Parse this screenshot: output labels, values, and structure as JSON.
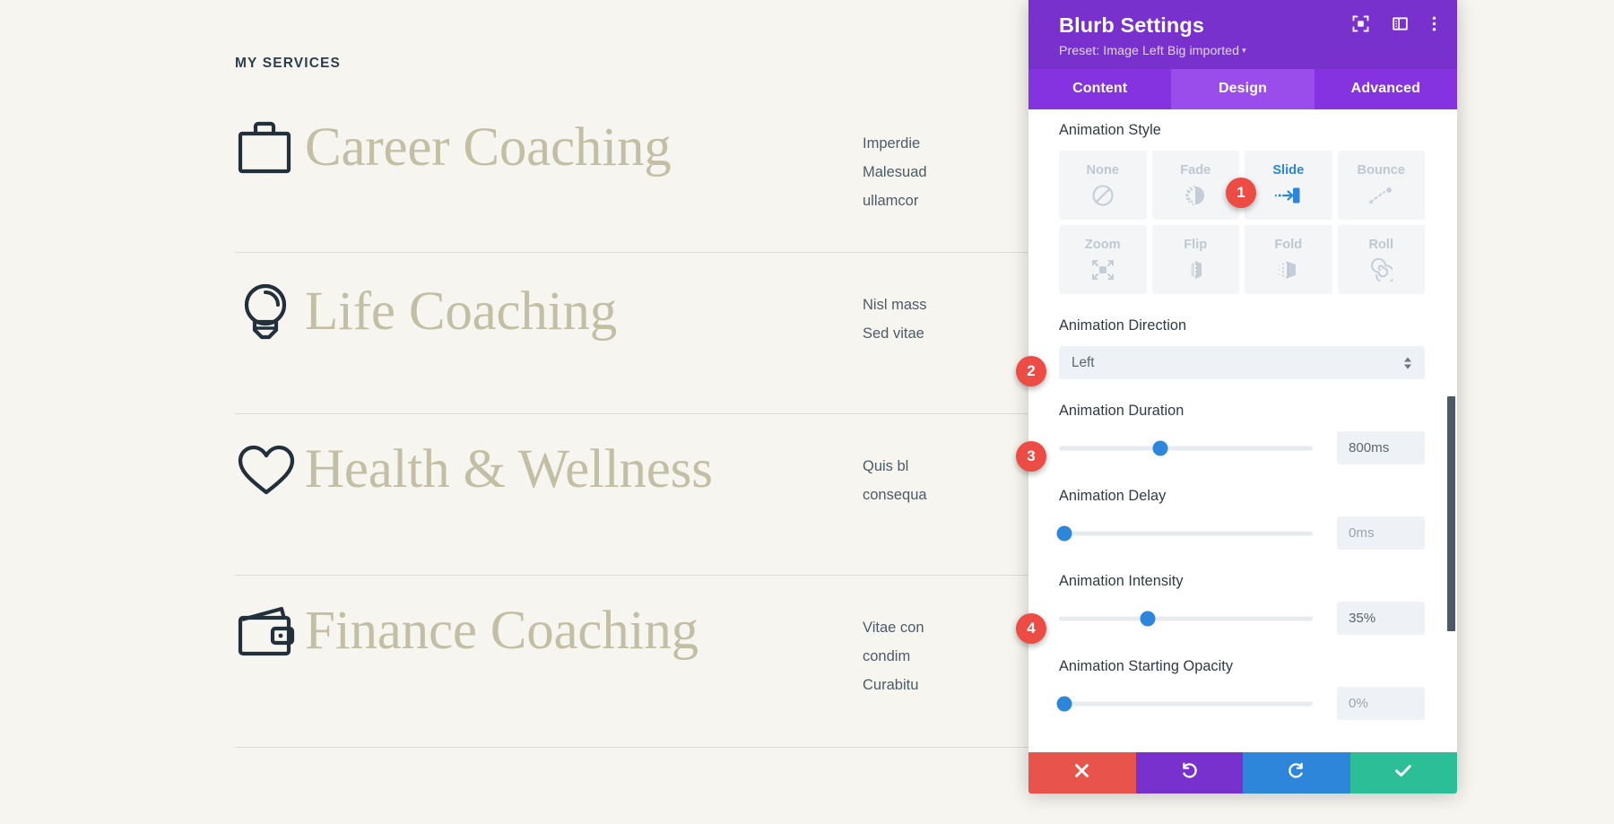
{
  "page": {
    "eyebrow": "MY SERVICES",
    "services": [
      {
        "icon": "briefcase-icon",
        "title": "Career Coaching",
        "body_lines": [
          "Imperdie",
          "Malesuad",
          "ullamcor"
        ]
      },
      {
        "icon": "lightbulb-icon",
        "title": "Life Coaching",
        "body_lines": [
          "Nisl mass",
          "Sed vitae"
        ]
      },
      {
        "icon": "heart-icon",
        "title": "Health & Wellness",
        "body_lines": [
          "Quis bl",
          "consequa"
        ]
      },
      {
        "icon": "wallet-icon",
        "title": "Finance Coaching",
        "body_lines": [
          "Vitae con",
          "condim",
          "Curabitu"
        ]
      }
    ]
  },
  "modal": {
    "title": "Blurb Settings",
    "preset_label": "Preset: Image Left Big imported",
    "preset_caret": "▾",
    "header_icons": [
      {
        "name": "focus-target-icon"
      },
      {
        "name": "layout-columns-icon"
      },
      {
        "name": "more-vertical-icon"
      }
    ],
    "tabs": [
      {
        "label": "Content",
        "active": false
      },
      {
        "label": "Design",
        "active": true
      },
      {
        "label": "Advanced",
        "active": false
      }
    ],
    "animation_style": {
      "label": "Animation Style",
      "options": [
        {
          "label": "None",
          "icon": "no-entry-icon",
          "selected": false
        },
        {
          "label": "Fade",
          "icon": "fade-icon",
          "selected": false
        },
        {
          "label": "Slide",
          "icon": "slide-icon",
          "selected": true
        },
        {
          "label": "Bounce",
          "icon": "bounce-icon",
          "selected": false
        },
        {
          "label": "Zoom",
          "icon": "zoom-arrows-icon",
          "selected": false
        },
        {
          "label": "Flip",
          "icon": "flip-icon",
          "selected": false
        },
        {
          "label": "Fold",
          "icon": "fold-icon",
          "selected": false
        },
        {
          "label": "Roll",
          "icon": "roll-spiral-icon",
          "selected": false
        }
      ]
    },
    "animation_direction": {
      "label": "Animation Direction",
      "value": "Left"
    },
    "animation_duration": {
      "label": "Animation Duration",
      "value": "800ms",
      "knob_percent": 40
    },
    "animation_delay": {
      "label": "Animation Delay",
      "value": "0ms",
      "knob_percent": 2
    },
    "animation_intensity": {
      "label": "Animation Intensity",
      "value": "35%",
      "knob_percent": 35
    },
    "animation_starting_opacity": {
      "label": "Animation Starting Opacity",
      "value": "0%",
      "knob_percent": 2
    },
    "footer": [
      {
        "name": "cancel-button",
        "icon": "x-icon",
        "color": "#e8534c"
      },
      {
        "name": "undo-button",
        "icon": "undo-icon",
        "color": "#7831cd"
      },
      {
        "name": "redo-button",
        "icon": "redo-icon",
        "color": "#2d86d9"
      },
      {
        "name": "save-button",
        "icon": "check-icon",
        "color": "#2cbe97"
      }
    ]
  },
  "badges": [
    {
      "number": "1"
    },
    {
      "number": "2"
    },
    {
      "number": "3"
    },
    {
      "number": "4"
    }
  ],
  "colors": {
    "brand_purple": "#7831cd",
    "tab_purple": "#8533e0",
    "tab_active_purple": "#9b4dec",
    "accent_blue": "#2d86d9",
    "page_bg": "#f7f5ef",
    "heading_tan": "#c3bfa4",
    "badge_red": "#ec4c43"
  }
}
